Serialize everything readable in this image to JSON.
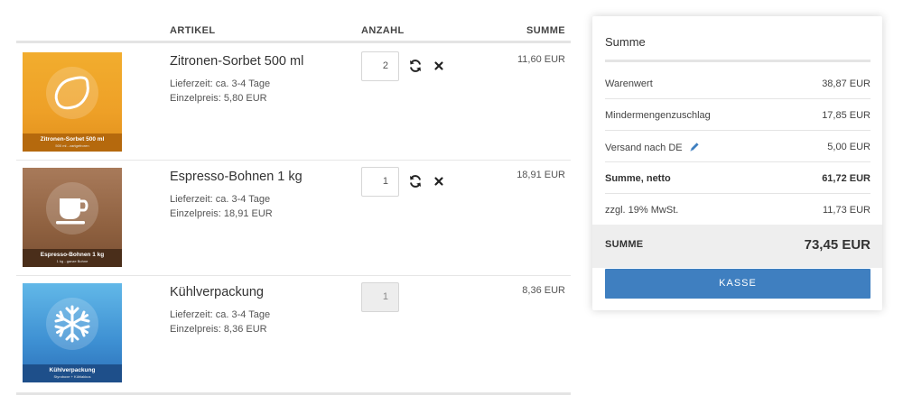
{
  "cart": {
    "columns": {
      "artikel": "ARTIKEL",
      "anzahl": "ANZAHL",
      "summe": "SUMME"
    },
    "items": [
      {
        "name": "Zitronen-Sorbet 500 ml",
        "delivery": "Lieferzeit: ca. 3-4 Tage",
        "unit_price": "Einzelpreis: 5,80 EUR",
        "quantity": "2",
        "sum": "11,60 EUR",
        "image_title": "Zitronen-Sorbet 500 ml",
        "image_subtitle": "500 ml - zartgefroren",
        "image_icon": "lemon-icon",
        "quantity_editable": true
      },
      {
        "name": "Espresso-Bohnen 1 kg",
        "delivery": "Lieferzeit: ca. 3-4 Tage",
        "unit_price": "Einzelpreis: 18,91 EUR",
        "quantity": "1",
        "sum": "18,91 EUR",
        "image_title": "Espresso-Bohnen 1 kg",
        "image_subtitle": "1 kg - ganze Bohne",
        "image_icon": "coffee-cup-icon",
        "quantity_editable": true
      },
      {
        "name": "Kühlverpackung",
        "delivery": "Lieferzeit: ca. 3-4 Tage",
        "unit_price": "Einzelpreis: 8,36 EUR",
        "quantity": "1",
        "sum": "8,36 EUR",
        "image_title": "Kühlverpackung",
        "image_subtitle": "Styroboxe + Kühlakkus",
        "image_icon": "snowflake-icon",
        "quantity_editable": false
      }
    ],
    "icons": {
      "refresh": "refresh-icon",
      "remove": "close-icon"
    }
  },
  "summary": {
    "title": "Summe",
    "rows": [
      {
        "label": "Warenwert",
        "value": "38,87 EUR"
      },
      {
        "label": "Mindermengenzuschlag",
        "value": "17,85 EUR"
      },
      {
        "label": "Versand nach DE",
        "value": "5,00 EUR",
        "icon": "pencil-icon"
      },
      {
        "label": "Summe, netto",
        "value": "61,72 EUR"
      },
      {
        "label": "zzgl. 19% MwSt.",
        "value": "11,73 EUR"
      }
    ],
    "total_label": "SUMME",
    "total_value": "73,45 EUR",
    "checkout_label": "KASSE"
  },
  "colors": {
    "accent": "#3f7fc0",
    "lemon_tile": "#eea027",
    "coffee_tile": "#8f6140",
    "ice_tile": "#3d8fd2"
  }
}
